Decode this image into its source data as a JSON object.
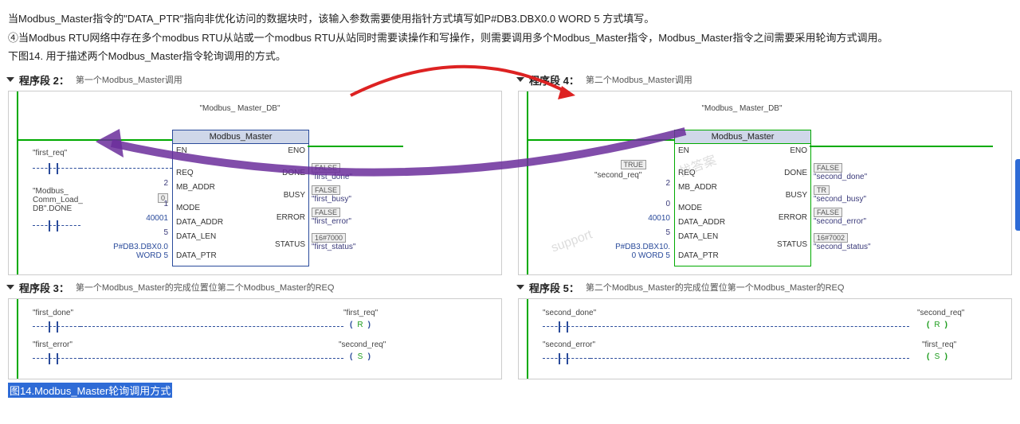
{
  "para1": "当Modbus_Master指令的\"DATA_PTR\"指向非优化访问的数据块时，该输入参数需要使用指针方式填写如P#DB3.DBX0.0 WORD 5 方式填写。",
  "para2": "④当Modbus RTU网络中存在多个modbus RTU从站或一个modbus RTU从站同时需要读操作和写操作，则需要调用多个Modbus_Master指令，Modbus_Master指令之间需要采用轮询方式调用。",
  "para3": "下图14. 用于描述两个Modbus_Master指令轮询调用的方式。",
  "caption": "图14.Modbus_Master轮询调用方式",
  "net2": {
    "title": "程序段 2：",
    "desc": "第一个Modbus_Master调用"
  },
  "net4": {
    "title": "程序段 4：",
    "desc": "第二个Modbus_Master调用"
  },
  "net3": {
    "title": "程序段 3：",
    "desc": "第一个Modbus_Master的完成位置位第二个Modbus_Master的REQ"
  },
  "net5": {
    "title": "程序段 5：",
    "desc": "第二个Modbus_Master的完成位置位第一个Modbus_Master的REQ"
  },
  "blk": {
    "db": "\"Modbus_\nMaster_DB\"",
    "name": "Modbus_Master",
    "pinL": [
      "EN",
      "REQ",
      "MB_ADDR",
      "MODE",
      "DATA_ADDR",
      "DATA_LEN",
      "DATA_PTR"
    ],
    "pinR": [
      "ENO",
      "DONE",
      "BUSY",
      "ERROR",
      "STATUS"
    ]
  },
  "vals2": {
    "req": "\"first_req\"",
    "mb": "2",
    "mode": "1",
    "mode_box": "0",
    "addr": "40001",
    "len": "5",
    "ptr": "P#DB3.DBX0.0\nWORD 5",
    "done": "\"first_done\"",
    "busy": "\"first_busy\"",
    "err": "\"first_error\"",
    "stat": "\"first_status\"",
    "stat_hex": "16#7000",
    "f": "FALSE",
    "side": "\"Modbus_\nComm_Load_\nDB\".DONE"
  },
  "vals4": {
    "req": "\"second_req\"",
    "mb": "2",
    "mode": "0",
    "addr": "40010",
    "len": "5",
    "ptr": "P#DB3.DBX10.\n0 WORD 5",
    "done": "\"second_done\"",
    "busy": "\"second_busy\"",
    "err": "\"second_error\"",
    "stat": "\"second_status\"",
    "stat_hex": "16#7002",
    "t": "TRUE",
    "f": "FALSE",
    "tr": "TR"
  },
  "rs": {
    "R": "R",
    "S": "S"
  },
  "net3v": {
    "a": "\"first_done\"",
    "b": "\"first_error\"",
    "c": "\"first_req\"",
    "d": "\"second_req\""
  },
  "net5v": {
    "a": "\"second_done\"",
    "b": "\"second_error\"",
    "c": "\"second_req\"",
    "d": "\"first_req\""
  }
}
